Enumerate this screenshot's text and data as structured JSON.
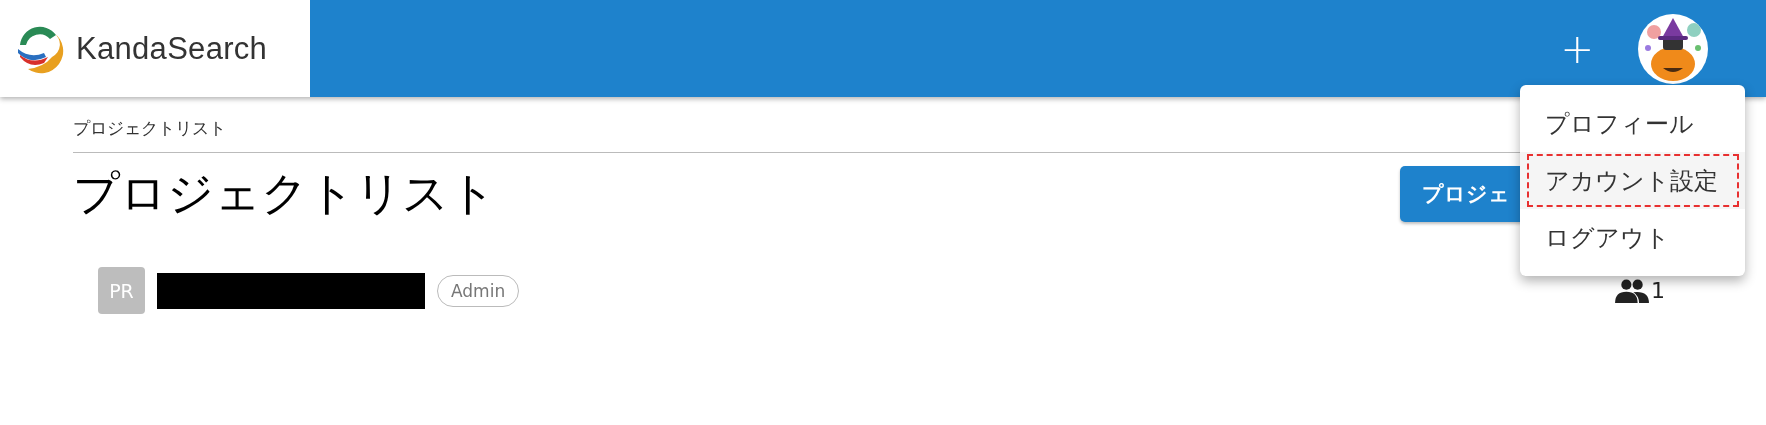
{
  "header": {
    "logo_text": "KandaSearch",
    "add_button": "+"
  },
  "breadcrumb": "プロジェクトリスト",
  "title": "プロジェクトリスト",
  "create_button": "プロジェ",
  "projects": [
    {
      "initials": "PR",
      "role": "Admin",
      "members": "1"
    }
  ],
  "user_menu": {
    "items": [
      {
        "label": "プロフィール",
        "selected": false
      },
      {
        "label": "アカウント設定",
        "selected": true
      },
      {
        "label": "ログアウト",
        "selected": false
      }
    ]
  }
}
